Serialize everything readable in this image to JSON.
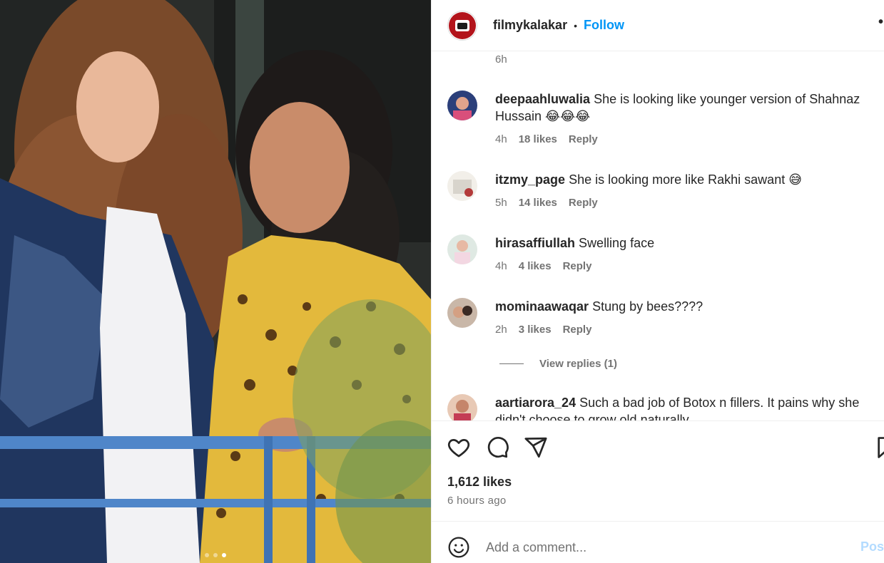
{
  "header": {
    "username": "filmykalakar",
    "separator": "•",
    "follow_label": "Follow",
    "more_icon": "more-options-icon"
  },
  "comments_top_time": "6h",
  "comments": [
    {
      "username": "deepaahluwalia",
      "text": "She is looking like younger version of Shahnaz Hussain 😂😂😂",
      "time": "4h",
      "likes": "18 likes",
      "reply": "Reply"
    },
    {
      "username": "itzmy_page",
      "text": "She is looking more like Rakhi sawant 😅",
      "time": "5h",
      "likes": "14 likes",
      "reply": "Reply"
    },
    {
      "username": "hirasaffiullah",
      "text": "Swelling face",
      "time": "4h",
      "likes": "4 likes",
      "reply": "Reply"
    },
    {
      "username": "mominaawaqar",
      "text": "Stung by bees????",
      "time": "2h",
      "likes": "3 likes",
      "reply": "Reply"
    },
    {
      "username": "aartiarora_24",
      "text": "Such a bad job of Botox n fillers. It pains why she didn't choose to grow old naturally",
      "time": "",
      "likes": "",
      "reply": ""
    }
  ],
  "view_replies": "View replies (1)",
  "actions": {
    "like_icon": "heart-icon",
    "comment_icon": "comment-icon",
    "share_icon": "share-icon",
    "save_icon": "bookmark-icon"
  },
  "likes_count": "1,612 likes",
  "post_time": "6 hours ago",
  "add_comment": {
    "placeholder": "Add a comment...",
    "post_label": "Post"
  },
  "colors": {
    "accent": "#0095f6",
    "text": "#262626",
    "muted": "#737373"
  }
}
